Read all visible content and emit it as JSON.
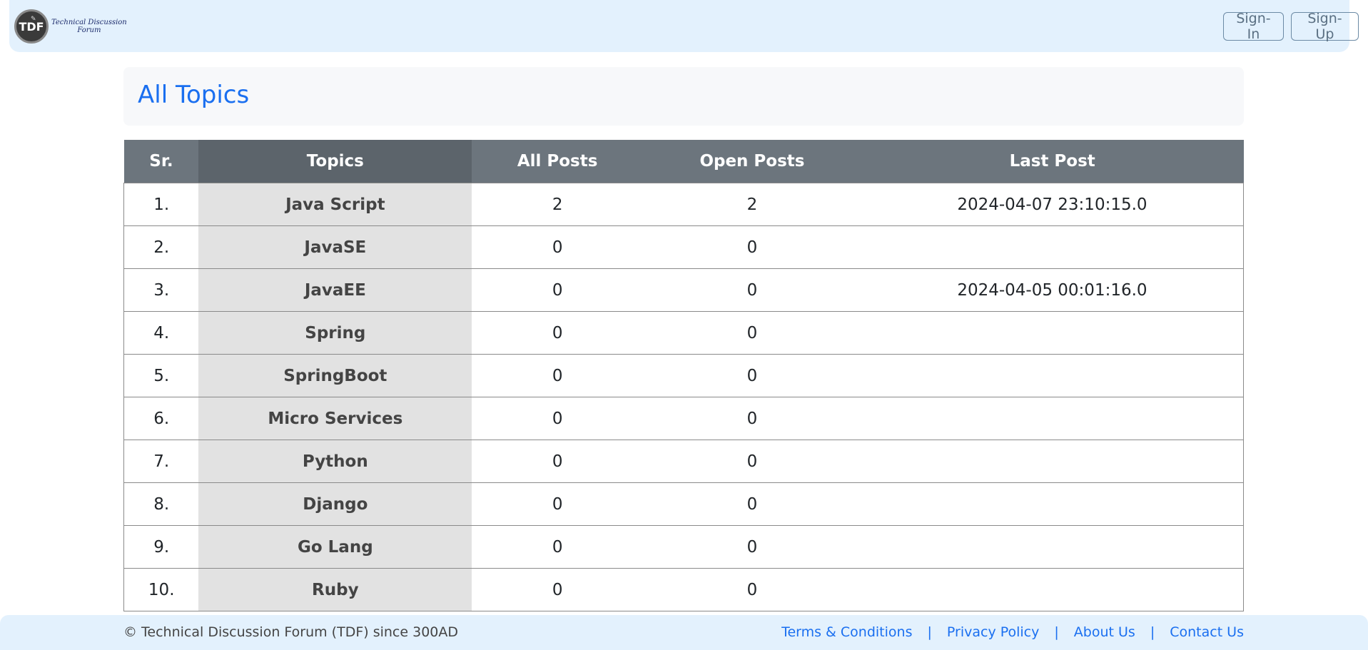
{
  "navbar": {
    "logo_badge": "TDF",
    "logo_text_line1": "Technical Discussion",
    "logo_text_line2": "Forum",
    "signin_label": "Sign-In",
    "signup_label": "Sign-Up",
    "background_color": "#e3f1fd"
  },
  "main": {
    "title": "All Topics",
    "title_color": "#1a6ff0"
  },
  "table": {
    "headers": {
      "sr": "Sr.",
      "topics": "Topics",
      "all_posts": "All Posts",
      "open_posts": "Open Posts",
      "last_post": "Last Post"
    },
    "rows": [
      {
        "sr": "1.",
        "topic": "Java Script",
        "all_posts": "2",
        "open_posts": "2",
        "last_post": "2024-04-07 23:10:15.0"
      },
      {
        "sr": "2.",
        "topic": "JavaSE",
        "all_posts": "0",
        "open_posts": "0",
        "last_post": ""
      },
      {
        "sr": "3.",
        "topic": "JavaEE",
        "all_posts": "0",
        "open_posts": "0",
        "last_post": "2024-04-05 00:01:16.0"
      },
      {
        "sr": "4.",
        "topic": "Spring",
        "all_posts": "0",
        "open_posts": "0",
        "last_post": ""
      },
      {
        "sr": "5.",
        "topic": "SpringBoot",
        "all_posts": "0",
        "open_posts": "0",
        "last_post": ""
      },
      {
        "sr": "6.",
        "topic": "Micro Services",
        "all_posts": "0",
        "open_posts": "0",
        "last_post": ""
      },
      {
        "sr": "7.",
        "topic": "Python",
        "all_posts": "0",
        "open_posts": "0",
        "last_post": ""
      },
      {
        "sr": "8.",
        "topic": "Django",
        "all_posts": "0",
        "open_posts": "0",
        "last_post": ""
      },
      {
        "sr": "9.",
        "topic": "Go Lang",
        "all_posts": "0",
        "open_posts": "0",
        "last_post": ""
      },
      {
        "sr": "10.",
        "topic": "Ruby",
        "all_posts": "0",
        "open_posts": "0",
        "last_post": ""
      }
    ]
  },
  "footer": {
    "copyright": "© Technical Discussion Forum (TDF) since 300AD",
    "separator": "|",
    "links": [
      {
        "label": "Terms & Conditions"
      },
      {
        "label": "Privacy Policy"
      },
      {
        "label": "About Us"
      },
      {
        "label": "Contact Us"
      }
    ]
  }
}
